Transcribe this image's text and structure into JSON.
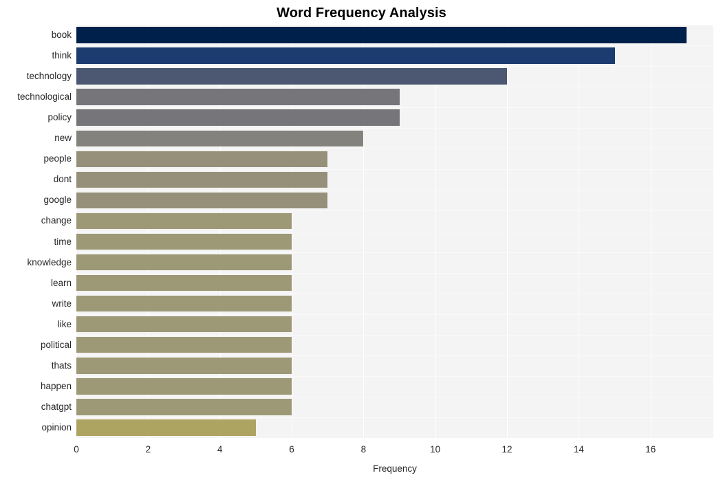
{
  "chart_data": {
    "type": "bar",
    "orientation": "horizontal",
    "title": "Word Frequency Analysis",
    "xlabel": "Frequency",
    "ylabel": "",
    "xlim": [
      0,
      17.75
    ],
    "ylim_categories": 20,
    "xticks": [
      0,
      2,
      4,
      6,
      8,
      10,
      12,
      14,
      16
    ],
    "xtick_labels": [
      "0",
      "2",
      "4",
      "6",
      "8",
      "10",
      "12",
      "14",
      "16"
    ],
    "grid": true,
    "grid_axis": "both",
    "legend": null,
    "categories": [
      "book",
      "think",
      "technology",
      "technological",
      "policy",
      "new",
      "people",
      "dont",
      "google",
      "change",
      "time",
      "knowledge",
      "learn",
      "write",
      "like",
      "political",
      "thats",
      "happen",
      "chatgpt",
      "opinion"
    ],
    "values": [
      17,
      15,
      12,
      9,
      9,
      8,
      7,
      7,
      7,
      6,
      6,
      6,
      6,
      6,
      6,
      6,
      6,
      6,
      6,
      5
    ],
    "bar_colors": [
      "#00204c",
      "#1c3b6e",
      "#4c5871",
      "#75757a",
      "#75757a",
      "#83827d",
      "#96907a",
      "#96907a",
      "#96907a",
      "#9d9876",
      "#9d9876",
      "#9d9876",
      "#9d9876",
      "#9d9876",
      "#9d9876",
      "#9d9876",
      "#9d9876",
      "#9d9876",
      "#9d9876",
      "#ada462"
    ],
    "colormap": "cividis",
    "plot_background": "#f4f4f4",
    "gridline_color": "#ffffff",
    "tick_label_color": "#262626",
    "title_color": "#000000"
  }
}
